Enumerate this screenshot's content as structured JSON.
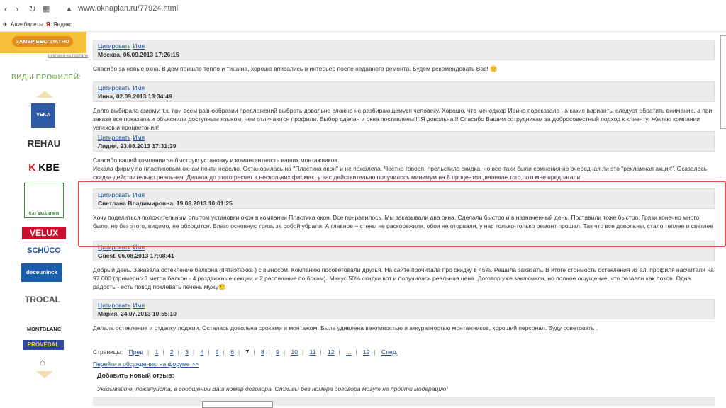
{
  "browser": {
    "url": "www.oknaplan.ru/77924.html",
    "bookmarks": [
      "Авиабилеты",
      "Яндекс"
    ]
  },
  "sidebar": {
    "promo_button": "ЗАМЕР БЕСПЛАТНО",
    "ad_note": "реклама на портале",
    "title": "ВИДЫ ПРОФИЛЕЙ:",
    "brands": [
      "VEKA",
      "REHAU",
      "KBE",
      "SALAMANDER",
      "VELUX",
      "SCHÜCO",
      "deceuninck",
      "TROCAL",
      "MONTBLANC",
      "PROVEDAL"
    ]
  },
  "posts": [
    {
      "quote": "Цитировать",
      "name_link": "Имя",
      "author": "Москва, 06.09.2013 17:26:15",
      "text": "Спасибо за новые окна. В дом пришло тепло и тишина, хорошо вписались в интерьер после недавнего ремонта. Будем рекомендовать Вас! 🙂"
    },
    {
      "quote": "Цитировать",
      "name_link": "Имя",
      "author": "Инна, 02.09.2013 13:34:49",
      "text": "Долго выбирала фирму, т.к. при всем разнообразии предложений выбрать довольно сложно не разбирающемуся человеку. Хорошо, что менеджер Ирина подсказала на какие варианты следует обратить внимание, а при заказе все показала и объяснила доступным языком, чем отличаются профили. Выбор сделан и окна поставлены!!! Я довольна!!! Спасибо Вашим сотрудникам за добросовестный подход к клиенту. Желаю компании успехов и процветания!"
    },
    {
      "quote": "Цитировать",
      "name_link": "Имя",
      "author": "Лидия, 23.08.2013 17:31:39",
      "text": "Спасибо вашей компании за быструю установку и компетентность ваших монтажников.\nИскала фирму по пластиковым окнам почти неделю. Остановилась на \"Пластика окон\" и не пожалела. Честно говоря, прельстила скидка, но все-таки были сомнения не очередная ли это \"рекламная акция\". Оказалось скидка действительно реальная! Делала до этого расчет в нескольких фирмах, у вас действительно получилось минимум на 8 процентов дешевле того, что мне предлагали."
    },
    {
      "quote": "Цитировать",
      "name_link": "Имя",
      "author": "Светлана Владимировна, 19.08.2013 10:01:25",
      "text": "Хочу поделиться положительным опытом установки окон в компании Пластика окон. Все понравилось. Мы заказывали два окна. Сделали быстро и в назначенный день. Поставили тоже быстро. Грязи конечно много было, но без этого, видимо, не обходится. Благо основную грязь за собой убрали. А главное – стены не раскорежили, обои не оторвали, у нас только-только ремонт прошел. Так что все довольны, стало теплее и светлее"
    },
    {
      "quote": "Цитировать",
      "name_link": "Имя",
      "author": "Guest, 06.08.2013 17:08:41",
      "text": "Добрый день. Заказала остекление балкона (пятиэтажка ) с выносом. Компанию посоветовали друзья. На сайте прочитала про скидку в 45%. Решила заказать. В итоге стоимость остекления из ал. профиля насчитали на 97 000 (примерно 3 метра балкон - 4 раздвижные секции и 2 распашные по бокам). Минус 50% скидки вот и получилась реальная цена. Договор уже заключили, но полное ощущение, что развели как лохов. Одна радость - есть повод поклевать печень мужу🙂"
    },
    {
      "quote": "Цитировать",
      "name_link": "Имя",
      "author": "Мария, 24.07.2013 10:55:10",
      "text": "Делала остекление и отделку лоджии. Осталась довольна сроками и монтажом. Была удивлена вежливостью и аккуратностью монтажников, хороший персонал. Буду советовать ."
    }
  ],
  "pager": {
    "label": "Страницы:",
    "prev": "Пред",
    "pages": [
      "1",
      "2",
      "3",
      "4",
      "5",
      "6",
      "7",
      "8",
      "9",
      "10",
      "11",
      "12",
      "...",
      "19"
    ],
    "current": "7",
    "next": "След."
  },
  "forum_link": "Перейти к обсуждению на форуме >>",
  "add_review": {
    "title": "Добавить новый отзыв:",
    "note": "Указывайте, пожалуйста, в сообщении Ваш номер договора. Отзывы без номера договора могут не пройти модерацию!"
  },
  "colors": {
    "link": "#1a4f9c",
    "highlight": "#d9534f",
    "sidebar_title": "#5aa02c",
    "promo": "#f6c13a"
  }
}
